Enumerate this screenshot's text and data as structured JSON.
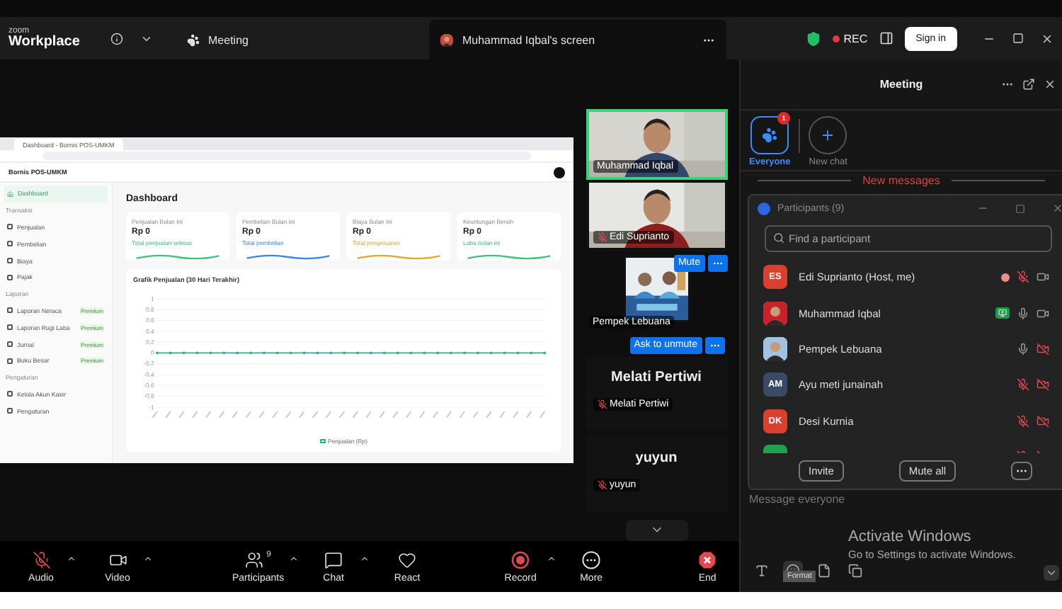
{
  "top_bar": {
    "logo": [
      "zoom",
      "Workplace"
    ],
    "tabs": [
      {
        "label": "Meeting",
        "selected": false
      },
      {
        "label": "Muhammad Iqbal's screen",
        "selected": true
      }
    ],
    "recording": "REC",
    "sign_in": "Sign in"
  },
  "shared_screen": {
    "browser_tab": "Dashboard - Bornis POS-UMKM",
    "app_name": "Bornis POS-UMKM",
    "sidebar": [
      {
        "kind": "item",
        "label": "Dashboard",
        "selected": true
      },
      {
        "kind": "section",
        "label": "Transaksi"
      },
      {
        "kind": "item",
        "label": "Penjualan",
        "selected": false
      },
      {
        "kind": "item",
        "label": "Pembelian",
        "selected": false
      },
      {
        "kind": "item",
        "label": "Biaya",
        "selected": false
      },
      {
        "kind": "item",
        "label": "Pajak",
        "selected": false
      },
      {
        "kind": "section",
        "label": "Laporan"
      },
      {
        "kind": "item",
        "label": "Laporan Neraca",
        "selected": false,
        "badge": "Premium"
      },
      {
        "kind": "item",
        "label": "Laporan Rugi Laba",
        "selected": false,
        "badge": "Premium"
      },
      {
        "kind": "item",
        "label": "Jurnal",
        "selected": false,
        "badge": "Premium"
      },
      {
        "kind": "item",
        "label": "Buku Besar",
        "selected": false,
        "badge": "Premium"
      },
      {
        "kind": "section",
        "label": "Pengaturan"
      },
      {
        "kind": "item",
        "label": "Kelola Akun Kasir",
        "selected": false
      },
      {
        "kind": "item",
        "label": "Pengaturan",
        "selected": false
      }
    ],
    "title": "Dashboard",
    "cards": [
      {
        "title": "Penjualan Bulan Ini",
        "value": "Rp 0",
        "note": "Total penjualan selesai",
        "color": "#3cc27a"
      },
      {
        "title": "Pembelian Bulan Ini",
        "value": "Rp 0",
        "note": "Total pembelian",
        "color": "#3b82f6"
      },
      {
        "title": "Biaya Bulan Ini",
        "value": "Rp 0",
        "note": "Total pengeluaran",
        "color": "#e0a82e"
      },
      {
        "title": "Keuntungan Bersih",
        "value": "Rp 0",
        "note": "Laba bulan ini",
        "color": "#3cc27a"
      }
    ],
    "chart_data": {
      "type": "line",
      "grid": true,
      "title": "Grafik Penjualan (30 Hari Terakhir)",
      "ylim": [
        -1,
        1
      ],
      "yticks": [
        1,
        0.8,
        0.6,
        0.4,
        0.2,
        0,
        -0.2,
        -0.4,
        -0.6,
        -0.8,
        -1
      ],
      "series": [
        {
          "name": "Penjualan (Rp)",
          "color": "#2bb38a",
          "values": [
            0,
            0,
            0,
            0,
            0,
            0,
            0,
            0,
            0,
            0,
            0,
            0,
            0,
            0,
            0,
            0,
            0,
            0,
            0,
            0,
            0,
            0,
            0,
            0,
            0,
            0,
            0,
            0,
            0,
            0
          ]
        }
      ]
    }
  },
  "videos": [
    {
      "kind": "camera",
      "name": "Muhammad Iqbal",
      "speaking": true,
      "muted": false
    },
    {
      "kind": "camera",
      "name": "Edi Suprianto",
      "speaking": false,
      "muted": true
    },
    {
      "kind": "picture",
      "name": "Pempek Lebuana",
      "speaking": false,
      "muted": false,
      "action": "Mute"
    },
    {
      "kind": "name_only",
      "title": "Melati Pertiwi",
      "name": "Melati Pertiwi",
      "speaking": false,
      "muted": true,
      "action": "Ask to unmute"
    },
    {
      "kind": "name_only",
      "title": "yuyun",
      "name": "yuyun",
      "speaking": false,
      "muted": true
    }
  ],
  "toolbar": [
    {
      "kind": "audio",
      "label": "Audio",
      "muted": true,
      "menu": true
    },
    {
      "kind": "video",
      "label": "Video",
      "menu": true
    },
    {
      "kind": "participants",
      "label": "Participants",
      "count": "9",
      "menu": true
    },
    {
      "kind": "chat",
      "label": "Chat",
      "menu": true
    },
    {
      "kind": "react",
      "label": "React",
      "menu": false
    },
    {
      "kind": "record",
      "label": "Record",
      "menu": true
    },
    {
      "kind": "more",
      "label": "More",
      "menu": false
    },
    {
      "kind": "end",
      "label": "End",
      "menu": false
    }
  ],
  "meeting_panel": {
    "title": "Meeting",
    "channels": [
      {
        "kind": "everyone",
        "label": "Everyone",
        "selected": true,
        "badge": "1"
      },
      {
        "kind": "new",
        "label": "New chat",
        "selected": false
      }
    ],
    "divider": "New messages",
    "composer": {
      "placeholder": "Message everyone"
    },
    "tooltip": "Format"
  },
  "participants": {
    "title": "Participants (9)",
    "search": {
      "placeholder": "Find a participant"
    },
    "rows": [
      {
        "kind": "initials",
        "initials": "ES",
        "color": "#d9412f",
        "name": "Edi Suprianto (Host, me)",
        "recording": true,
        "sharing": false,
        "mic_on": false,
        "video_on": true
      },
      {
        "name": "Muhammad Iqbal",
        "recording": false,
        "sharing": true,
        "mic_on": true,
        "video_on": true
      },
      {
        "name": "Pempek Lebuana",
        "recording": false,
        "sharing": false,
        "mic_on": true,
        "video_on": false
      },
      {
        "kind": "initials",
        "initials": "AM",
        "color": "#3b4a63",
        "name": "Ayu meti junainah",
        "recording": false,
        "sharing": false,
        "mic_on": false,
        "video_on": false
      },
      {
        "kind": "initials",
        "initials": "DK",
        "color": "#d9412f",
        "name": "Desi Kurnia",
        "recording": false,
        "sharing": false,
        "mic_on": false,
        "video_on": false
      },
      {
        "kind": "initials",
        "color": "#22a04b",
        "recording": false,
        "sharing": false,
        "mic_on": false,
        "video_on": false
      }
    ],
    "buttons": [
      "Invite",
      "Mute all"
    ]
  },
  "os_notice": {
    "title": "Activate Windows",
    "text": "Go to Settings to activate Windows."
  }
}
